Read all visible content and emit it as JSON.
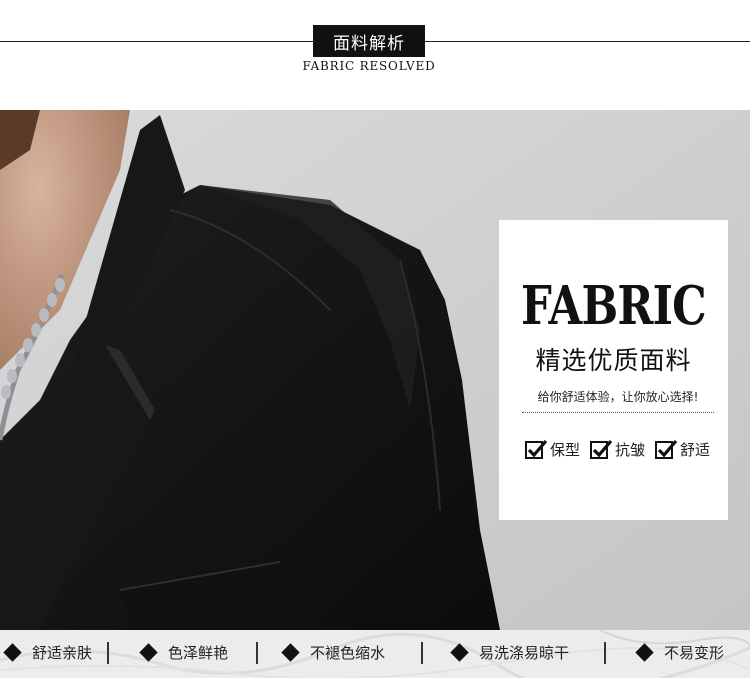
{
  "header": {
    "title": "面料解析",
    "subtitle": "FABRIC RESOLVED"
  },
  "card": {
    "title": "FABRIC",
    "headline": "精选优质面料",
    "tagline": "给你舒适体验，让你放心选择!",
    "checks": [
      {
        "label": "保型"
      },
      {
        "label": "抗皱"
      },
      {
        "label": "舒适"
      }
    ]
  },
  "features": [
    {
      "label": "舒适亲肤"
    },
    {
      "label": "色泽鲜艳"
    },
    {
      "label": "不褪色缩水"
    },
    {
      "label": "易洗涤易晾干"
    },
    {
      "label": "不易变形"
    }
  ],
  "colors": {
    "header_box": "#111111",
    "card_bg": "#ffffff",
    "jacket": "#141516",
    "wall": "#cfd0d1",
    "strip": "#ececec"
  }
}
